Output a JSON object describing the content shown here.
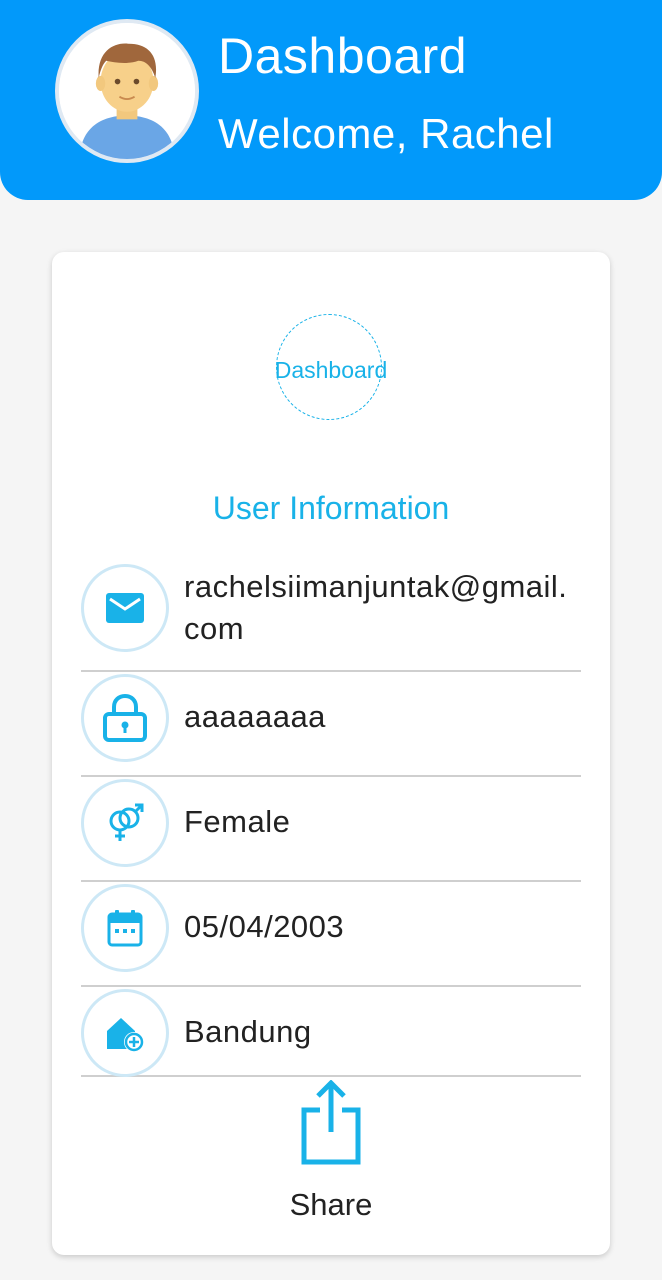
{
  "header": {
    "title": "Dashboard",
    "subtitle": "Welcome, Rachel",
    "avatar_icon": "user-avatar-icon",
    "background_color": "#0299fa"
  },
  "card": {
    "logo_text": "Dashboard",
    "section_title": "User Information",
    "accent_color": "#19b2e8",
    "rows": [
      {
        "icon": "email-icon",
        "value": "rachelsiimanjuntak@gmail.com"
      },
      {
        "icon": "lock-icon",
        "value": "aaaaaaaa"
      },
      {
        "icon": "gender-icon",
        "value": "Female"
      },
      {
        "icon": "calendar-icon",
        "value": "05/04/2003"
      },
      {
        "icon": "home-location-icon",
        "value": "Bandung"
      }
    ],
    "share": {
      "icon": "share-icon",
      "label": "Share"
    }
  }
}
